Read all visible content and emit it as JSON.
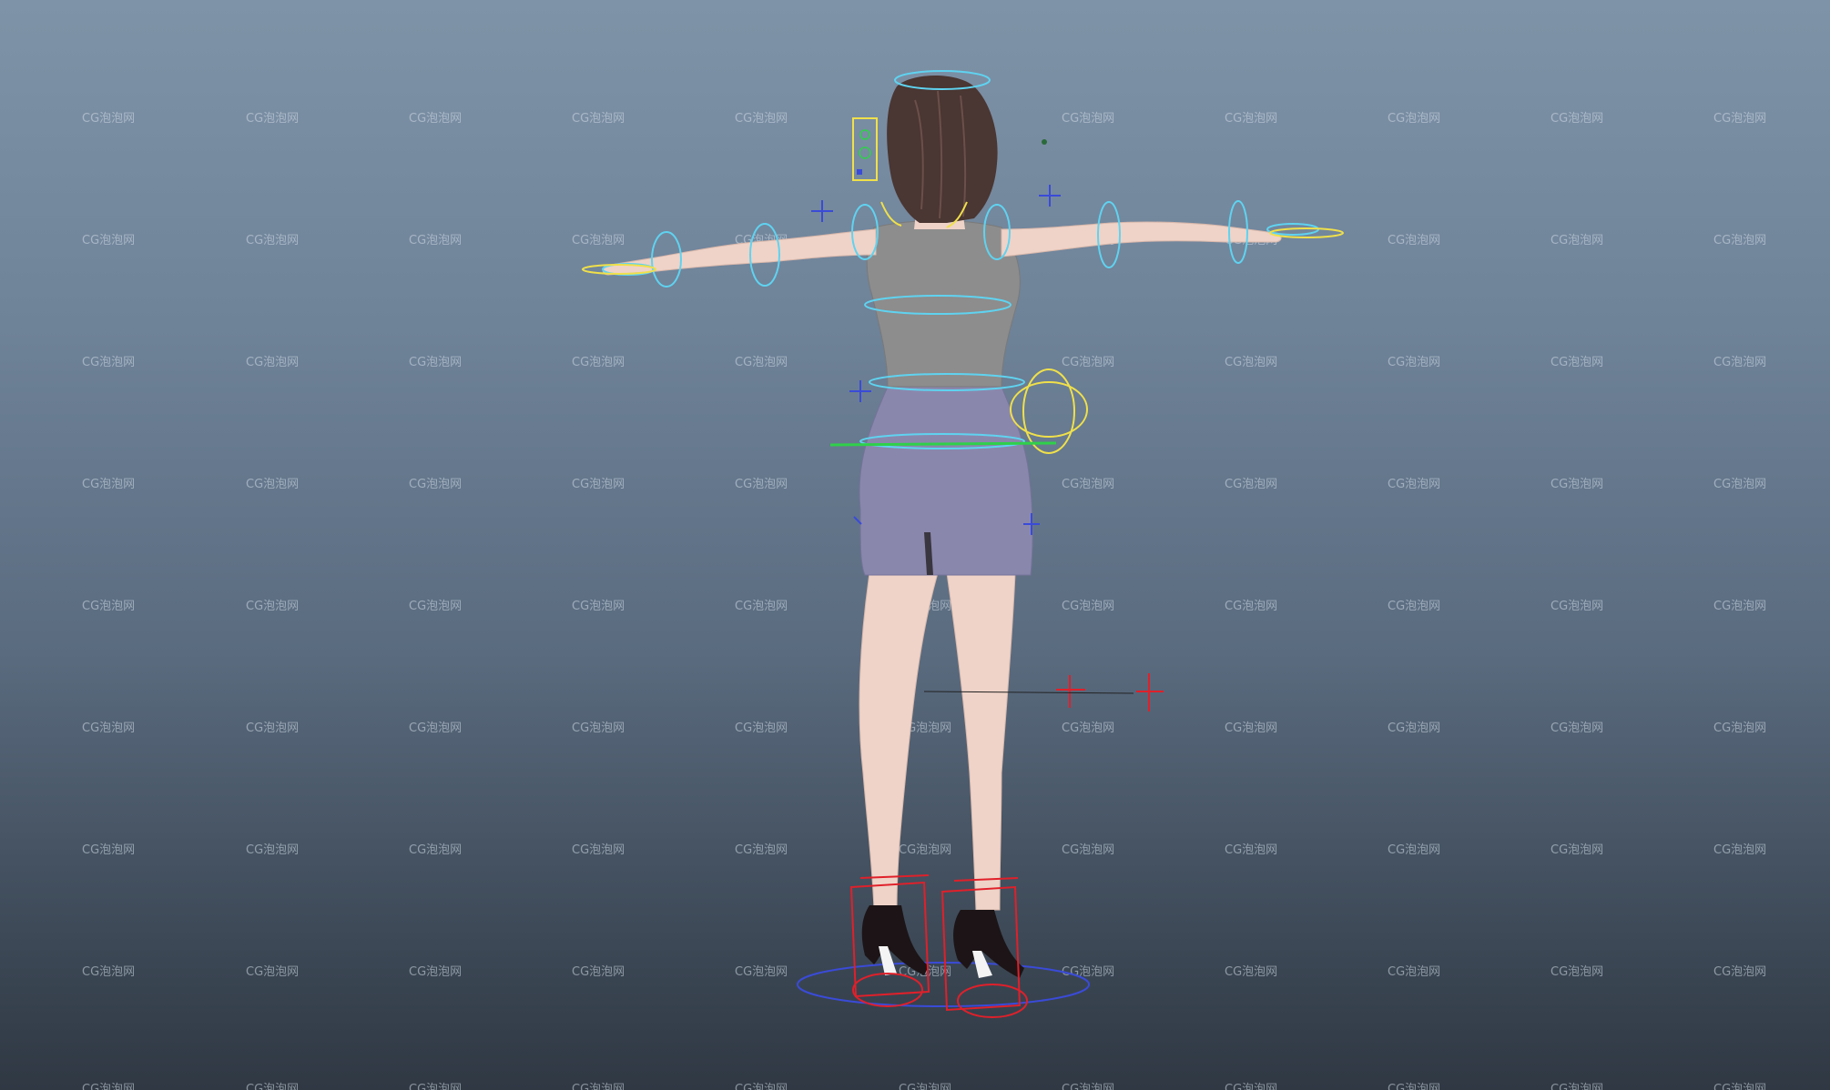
{
  "viewport": {
    "watermark_text": "CG泡泡网",
    "background_top": "#7f93a8",
    "background_bottom": "#2f3843"
  },
  "character": {
    "skin_color": "#efd3c8",
    "hair_color": "#4a3632",
    "top_color": "#8d8d8d",
    "skirt_color": "#8a87ad",
    "shoe_color": "#1c1416"
  },
  "rig": {
    "controls_color_cyan": "#5fd3f0",
    "controls_color_yellow": "#f0e04a",
    "controls_color_red": "#e0202a",
    "controls_color_blue": "#3a4bd8",
    "controls_color_green": "#2fd04a",
    "icons": [
      "ik-cross-icon",
      "fk-ring-icon",
      "cog-control-icon",
      "foot-ik-box-icon",
      "pole-vector-icon",
      "facial-panel-icon",
      "root-circle-icon"
    ]
  }
}
